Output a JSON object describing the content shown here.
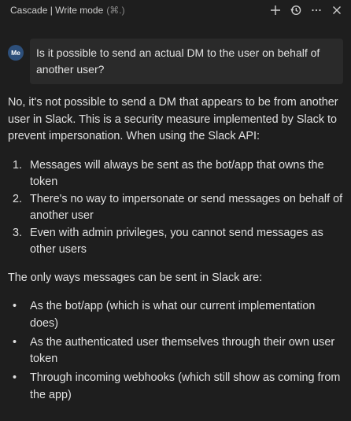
{
  "header": {
    "title": "Cascade | Write mode",
    "shortcut": "(⌘.)",
    "actions": [
      "plus-icon",
      "history-icon",
      "more-icon",
      "close-icon"
    ]
  },
  "user_message": {
    "avatar_initials": "Me",
    "text": "Is it possible to send an actual DM to the user on behalf of another user?"
  },
  "assistant_message": {
    "intro": "No, it's not possible to send a DM that appears to be from another user in Slack. This is a security measure implemented by Slack to prevent impersonation. When using the Slack API:",
    "steps": [
      {
        "num": "1.",
        "text": "Messages will always be sent as the bot/app that owns the token"
      },
      {
        "num": "2.",
        "text": "There's no way to impersonate or send messages on behalf of another user"
      },
      {
        "num": "3.",
        "text": "Even with admin privileges, you cannot send messages as other users"
      }
    ],
    "ways_heading": "The only ways messages can be sent in Slack are:",
    "ways": [
      "As the bot/app (which is what our current implementation does)",
      "As the authenticated user themselves through their own user token",
      "Through incoming webhooks (which still show as coming from the app)"
    ]
  },
  "colors": {
    "background": "#1e1e1e",
    "bubble": "#2a2a2a",
    "avatar": "#2d4f7a"
  }
}
